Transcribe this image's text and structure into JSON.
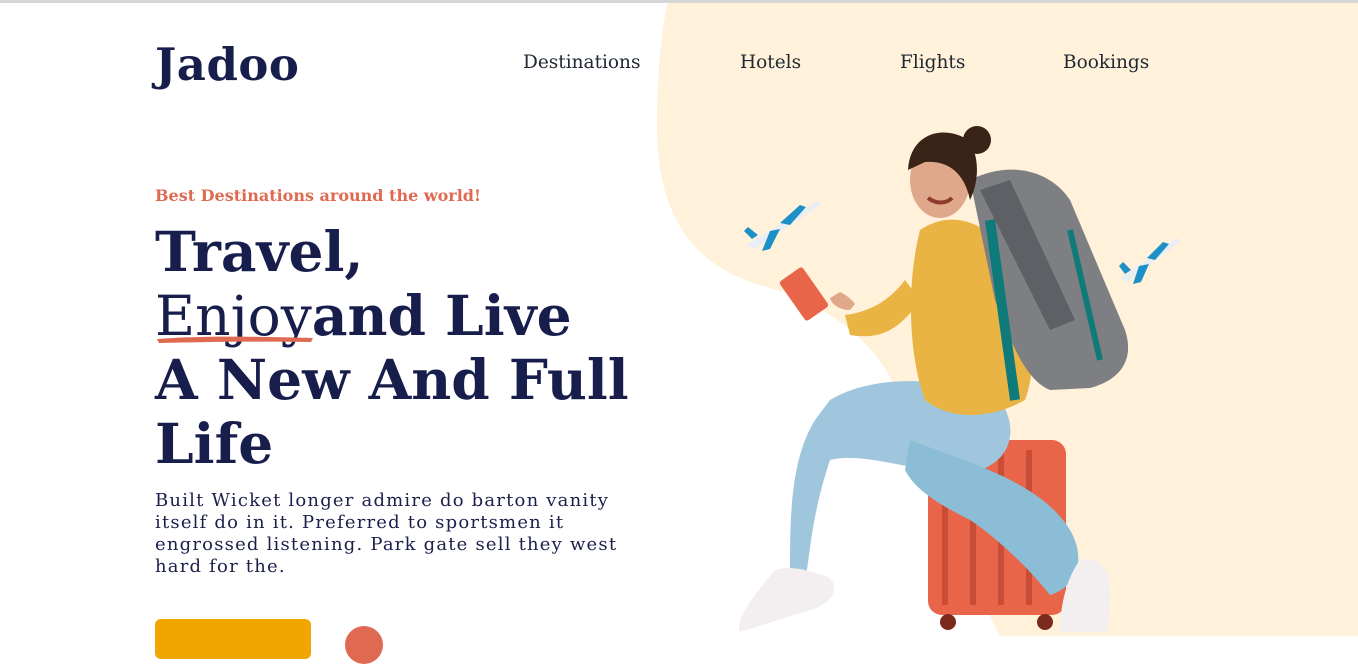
{
  "brand": {
    "logo": "Jadoo"
  },
  "nav": {
    "items": [
      {
        "label": "Destinations"
      },
      {
        "label": "Hotels"
      },
      {
        "label": "Flights"
      },
      {
        "label": "Bookings"
      }
    ]
  },
  "hero": {
    "tagline": "Best Destinations around the world!",
    "headline_line1": "Travel,",
    "headline_enjoy": "Enjoy",
    "headline_line2_rest": "and Live",
    "headline_line3": "A New And Full",
    "headline_line4": "Life",
    "description": "Built Wicket longer admire do barton vanity itself do in it. Preferred to sportsmen it engrossed listening. Park gate sell they west hard for the.",
    "image": "traveler-with-backpack-on-suitcase"
  },
  "colors": {
    "navy": "#181e4b",
    "accent_red": "#df6951",
    "accent_orange": "#f1a501",
    "blob": "#fff1da"
  }
}
